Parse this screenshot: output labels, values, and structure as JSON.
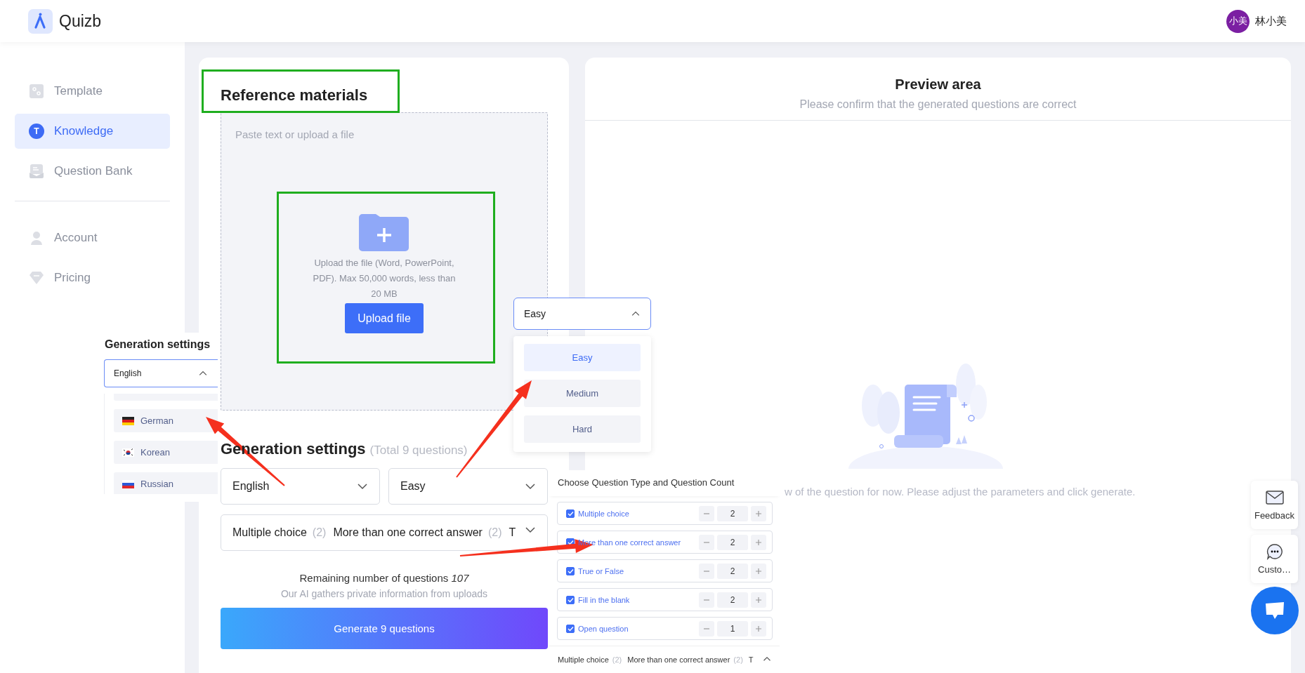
{
  "header": {
    "logo_text": "Quizb",
    "avatar_text": "小美",
    "user_name": "林小美"
  },
  "sidebar": {
    "sections": [
      {
        "items": [
          {
            "label": "Template",
            "kind": "template",
            "selected": false
          },
          {
            "label": "Knowledge",
            "kind": "letter",
            "icon_text": "T",
            "selected": true
          },
          {
            "label": "Question Bank",
            "kind": "bank",
            "selected": false
          }
        ]
      },
      {
        "items": [
          {
            "label": "Account",
            "kind": "person",
            "selected": false
          },
          {
            "label": "Pricing",
            "kind": "diamond",
            "selected": false
          }
        ]
      }
    ]
  },
  "reference": {
    "title": "Reference materials",
    "placeholder": "Paste text or upload a file",
    "upload_hint": "Upload the file (Word, PowerPoint, PDF). Max 50,000 words, less than 20 MB",
    "upload_button": "Upload file"
  },
  "settings": {
    "title": "Generation settings",
    "total": "(Total 9 questions)",
    "language": {
      "value": "English",
      "expanded": false
    },
    "difficulty": {
      "value": "Easy",
      "expanded": false
    },
    "question_types": {
      "expanded": false,
      "segments": [
        {
          "label": "Multiple choice",
          "count": "(2)"
        },
        {
          "label": "More than one correct answer",
          "count": "(2)"
        },
        {
          "label": "T"
        }
      ]
    },
    "remaining": "Remaining number of questions *107*",
    "privacy_note": "Our AI gathers private information from uploads",
    "generate_button": "Generate 9 questions"
  },
  "preview": {
    "title": "Preview area",
    "subtitle": "Please confirm that the generated questions are correct",
    "empty_text": "w of the question for now. Please adjust the parameters and click generate."
  },
  "floating_buttons": [
    {
      "kind": "feedback",
      "label": "Feedback"
    },
    {
      "kind": "support",
      "label": "Custo…"
    },
    {
      "kind": "chat"
    }
  ],
  "language_popup": {
    "title": "Generation settings",
    "value": "English",
    "expanded": true,
    "options": [
      {
        "label": "German",
        "kind": "de",
        "selected": false
      },
      {
        "label": "Korean",
        "kind": "kr",
        "selected": false
      },
      {
        "label": "Russian",
        "kind": "ru",
        "selected": false
      }
    ]
  },
  "difficulty_popup": {
    "value": "Easy",
    "expanded": true,
    "options": [
      {
        "label": "Easy",
        "selected": true
      },
      {
        "label": "Medium",
        "selected": false
      },
      {
        "label": "Hard",
        "selected": false
      }
    ]
  },
  "question_type_popup": {
    "title": "Choose Question Type and Question Count",
    "rows": [
      {
        "label": "Multiple choice",
        "checked": true,
        "count": "2"
      },
      {
        "label": "More than one correct answer",
        "checked": true,
        "count": "2"
      },
      {
        "label": "True or False",
        "checked": true,
        "count": "2"
      },
      {
        "label": "Fill in the blank",
        "checked": true,
        "count": "2"
      },
      {
        "label": "Open question",
        "checked": true,
        "count": "1"
      }
    ],
    "summary": {
      "expanded": true,
      "segments": [
        {
          "label": "Multiple choice",
          "count": "(2)"
        },
        {
          "label": "More than one correct answer",
          "count": "(2)"
        },
        {
          "label": "T"
        }
      ]
    }
  }
}
